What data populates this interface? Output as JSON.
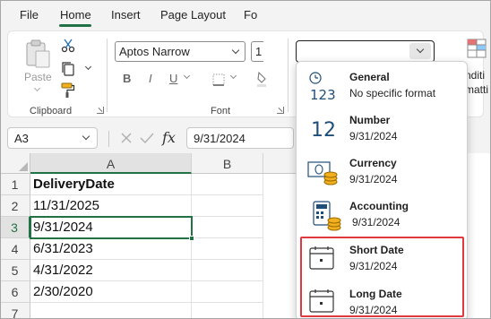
{
  "menu": {
    "tabs": [
      "File",
      "Home",
      "Insert",
      "Page Layout",
      "Fo"
    ],
    "active": "Home"
  },
  "clipboard": {
    "paste_label": "Paste",
    "group_label": "Clipboard"
  },
  "font": {
    "font_name": "Aptos Narrow",
    "font_size": "1",
    "bold": "B",
    "italic": "I",
    "underline": "U",
    "group_label": "Font"
  },
  "number_format": {
    "current_value": "",
    "dropdown_items": [
      {
        "title": "General",
        "subtitle": "No specific format",
        "icon": "general-123-icon"
      },
      {
        "title": "Number",
        "subtitle": "9/31/2024",
        "icon": "number-12-icon"
      },
      {
        "title": "Currency",
        "subtitle": "9/31/2024",
        "icon": "currency-icon"
      },
      {
        "title": "Accounting",
        "subtitle": "9/31/2024",
        "icon": "accounting-icon"
      },
      {
        "title": "Short Date",
        "subtitle": "9/31/2024",
        "icon": "short-date-calendar-icon"
      },
      {
        "title": "Long Date",
        "subtitle": "9/31/2024",
        "icon": "long-date-calendar-icon"
      }
    ],
    "highlighted_items": [
      "Short Date",
      "Long Date"
    ]
  },
  "ribbon_right": {
    "label_line1": "nditi",
    "label_line2": "matti"
  },
  "formula_bar": {
    "name_box": "A3",
    "fx_symbol": "fx",
    "formula": "9/31/2024"
  },
  "sheet": {
    "columns": [
      "A",
      "B"
    ],
    "rows": [
      "1",
      "2",
      "3",
      "4",
      "5",
      "6",
      "7"
    ],
    "cells": [
      "DeliveryDate",
      "11/31/2025",
      "9/31/2024",
      "6/31/2023",
      "4/31/2022",
      "2/30/2020",
      ""
    ],
    "selected_cell": "A3"
  },
  "colors": {
    "accent_green": "#217346",
    "highlight_red": "#e0393e",
    "icon_blue": "#1f4e79",
    "coin_gold": "#f2b01e"
  }
}
